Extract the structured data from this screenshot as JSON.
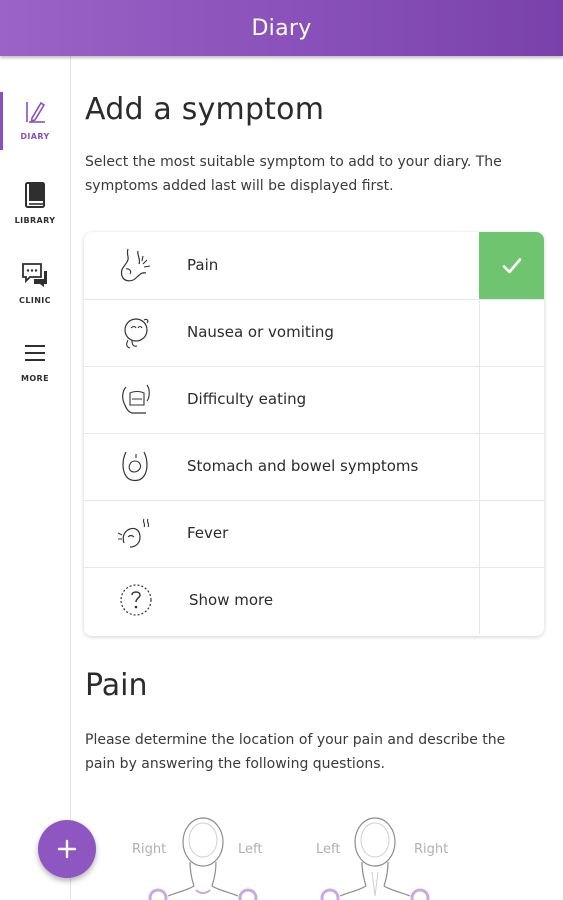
{
  "header": {
    "title": "Diary"
  },
  "sidebar": {
    "items": [
      {
        "label": "DIARY",
        "icon": "pencil-icon",
        "active": true
      },
      {
        "label": "LIBRARY",
        "icon": "book-icon",
        "active": false
      },
      {
        "label": "CLINIC",
        "icon": "chat-icon",
        "active": false
      },
      {
        "label": "MORE",
        "icon": "menu-icon",
        "active": false
      }
    ]
  },
  "main": {
    "title": "Add a symptom",
    "description": "Select the most suitable symptom to add to your diary. The symptoms added last will be displayed first.",
    "symptoms": [
      {
        "label": "Pain",
        "icon": "pain-icon",
        "selected": true
      },
      {
        "label": "Nausea or vomiting",
        "icon": "nausea-icon",
        "selected": false
      },
      {
        "label": "Difficulty eating",
        "icon": "eating-icon",
        "selected": false
      },
      {
        "label": "Stomach and bowel symptoms",
        "icon": "stomach-icon",
        "selected": false
      },
      {
        "label": "Fever",
        "icon": "fever-icon",
        "selected": false
      },
      {
        "label": "Show more",
        "icon": "question-icon",
        "selected": false
      }
    ],
    "pain_section": {
      "title": "Pain",
      "description": "Please determine the location of your pain and describe the pain by answering the following questions.",
      "front_right": "Right",
      "front_left": "Left",
      "back_left": "Left",
      "back_right": "Right"
    }
  },
  "colors": {
    "header_purple": "#8a52ba",
    "accent_purple": "#8a4fbd",
    "selected_green": "#6fc56f"
  }
}
